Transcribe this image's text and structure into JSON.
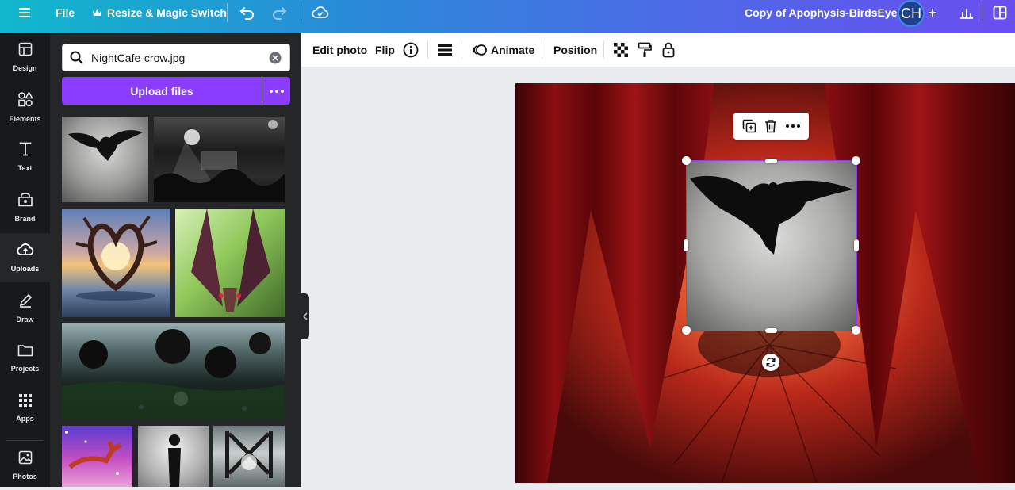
{
  "topbar": {
    "file_label": "File",
    "resize_label": "Resize & Magic Switch",
    "doc_title": "Copy of Apophysis-BirdsEye",
    "avatar_initials": "CH"
  },
  "rail": {
    "items": [
      {
        "label": "Design",
        "icon": "layout-icon"
      },
      {
        "label": "Elements",
        "icon": "shapes-icon"
      },
      {
        "label": "Text",
        "icon": "text-icon"
      },
      {
        "label": "Brand",
        "icon": "brand-icon"
      },
      {
        "label": "Uploads",
        "icon": "cloud-upload-icon",
        "active": true
      },
      {
        "label": "Draw",
        "icon": "pen-icon"
      },
      {
        "label": "Projects",
        "icon": "folder-icon"
      },
      {
        "label": "Apps",
        "icon": "apps-grid-icon"
      },
      {
        "label": "Photos",
        "icon": "image-icon"
      }
    ]
  },
  "panel": {
    "search_value": "NightCafe-crow.jpg",
    "upload_label": "Upload files"
  },
  "toolbar": {
    "edit_photo": "Edit photo",
    "flip": "Flip",
    "animate": "Animate",
    "position": "Position"
  },
  "colors": {
    "accent": "#8b3dff",
    "rail_bg": "#18191b",
    "panel_bg": "#252627",
    "curtain_red": "#8a0e12"
  }
}
